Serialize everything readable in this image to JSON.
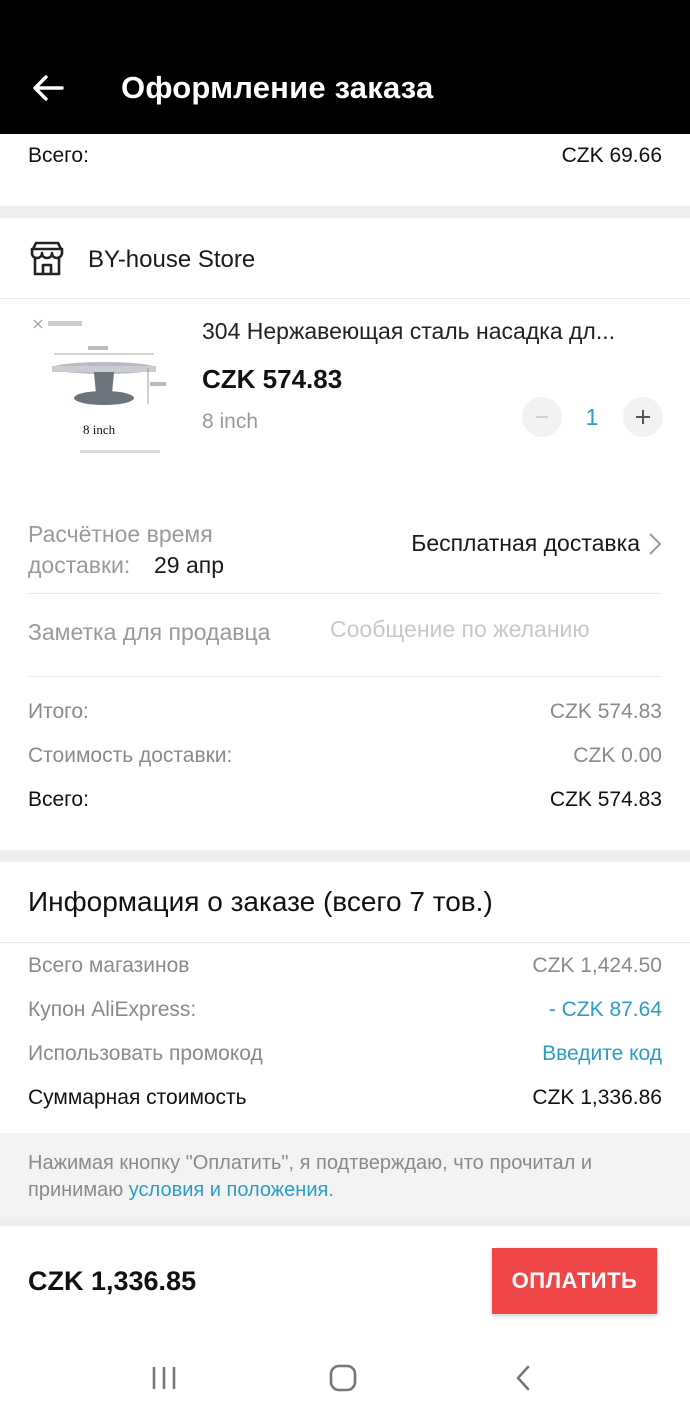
{
  "header": {
    "title": "Оформление заказа",
    "back_icon": "arrow-left-icon"
  },
  "prev_store": {
    "total_label": "Всего:",
    "total_value": "CZK 69.66"
  },
  "store": {
    "icon": "store-icon",
    "name": "BY-house Store",
    "product": {
      "title": "304 Нержавеющая сталь насадка дл...",
      "price": "CZK 574.83",
      "variant": "8 inch",
      "quantity": "1",
      "image_caption": "8 inch"
    },
    "delivery": {
      "label": "Расчётное время доставки:",
      "date": "29 апр",
      "shipping": "Бесплатная доставка"
    },
    "note": {
      "label": "Заметка для продавца",
      "placeholder": "Сообщение по желанию",
      "value": ""
    },
    "summary": {
      "subtotal_label": "Итого:",
      "subtotal_value": "CZK 574.83",
      "shipping_label": "Стоимость доставки:",
      "shipping_value": "CZK 0.00",
      "total_label": "Всего:",
      "total_value": "CZK 574.83"
    }
  },
  "order_info": {
    "title": "Информация о заказе (всего 7 тов.)",
    "stores_total_label": "Всего магазинов",
    "stores_total_value": "CZK 1,424.50",
    "coupon_label": "Купон AliExpress:",
    "coupon_value": "- CZK 87.64",
    "promo_label": "Использовать промокод",
    "promo_link": "Введите код",
    "grand_total_label": "Суммарная стоимость",
    "grand_total_value": "CZK 1,336.86"
  },
  "terms": {
    "text": "Нажимая кнопку \"Оплатить\", я подтверждаю, что прочитал и принимаю ",
    "link": "условия и положения",
    "end": "."
  },
  "pay": {
    "total": "CZK 1,336.85",
    "button": "ОПЛАТИТЬ"
  },
  "system_nav": {
    "recents_icon": "recents-icon",
    "home_icon": "home-icon",
    "back_icon": "back-chevron-icon"
  },
  "colors": {
    "accent_blue": "#2a9dc6",
    "pay_red": "#ee4646",
    "header_bg": "#000000"
  }
}
